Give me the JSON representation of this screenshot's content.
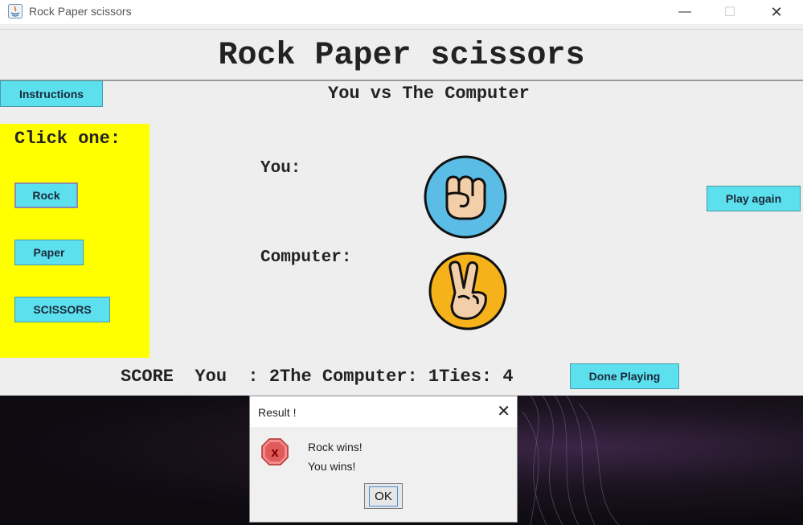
{
  "window": {
    "title": "Rock Paper scissors",
    "controls": [
      "—",
      "☐",
      "✕"
    ]
  },
  "header": {
    "title": "Rock Paper scissors"
  },
  "subtitle": "You vs The Computer",
  "buttons": {
    "instructions": "Instructions",
    "play_again": "Play again",
    "done_playing": "Done Playing"
  },
  "choices": {
    "label": "Click one:",
    "rock": "Rock",
    "paper": "Paper",
    "scissors": "SCISSORS",
    "selected": "Rock"
  },
  "players": {
    "you_label": "You:",
    "you_choice_icon": "fist-icon",
    "computer_label": "Computer:",
    "computer_choice_icon": "peace-sign-icon"
  },
  "score": {
    "you_label": "SCORE  You  : ",
    "you_value": "2",
    "computer_label": "The Computer: ",
    "computer_value": "1",
    "ties_label": "Ties: ",
    "ties_value": "4"
  },
  "dialog": {
    "title": "Result !",
    "close": "✕",
    "line1": "Rock wins!",
    "line2": "You wins!",
    "ok": "OK",
    "icon": "error-icon"
  },
  "colors": {
    "accent_button": "#5ce0ee",
    "choice_panel": "#ffff00",
    "you_circle": "#5bbde6",
    "computer_circle": "#f6b21a"
  }
}
